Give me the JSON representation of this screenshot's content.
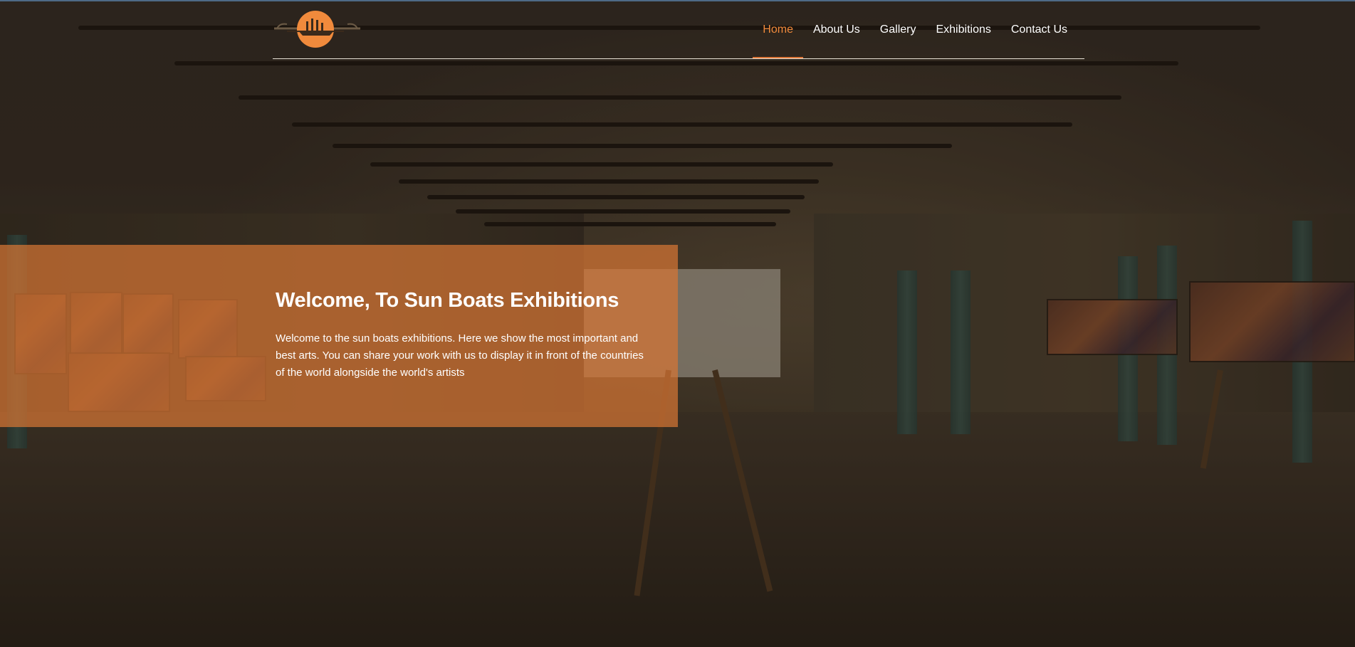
{
  "header": {
    "logo_alt": "Sun Boats logo",
    "nav": [
      {
        "label": "Home",
        "active": true
      },
      {
        "label": "About Us",
        "active": false
      },
      {
        "label": "Gallery",
        "active": false
      },
      {
        "label": "Exhibitions",
        "active": false
      },
      {
        "label": "Contact Us",
        "active": false
      }
    ]
  },
  "hero": {
    "title": "Welcome, To Sun Boats Exhibitions",
    "text": "Welcome to the sun boats exhibitions. Here we show the most important and best arts. You can share your work with us to display it in front of the countries of the world alongside the world's artists"
  },
  "colors": {
    "accent": "#f08a3c",
    "panel": "#d67634",
    "text": "#ffffff"
  },
  "icons": {
    "logo": "sun-boat-logo-icon"
  }
}
